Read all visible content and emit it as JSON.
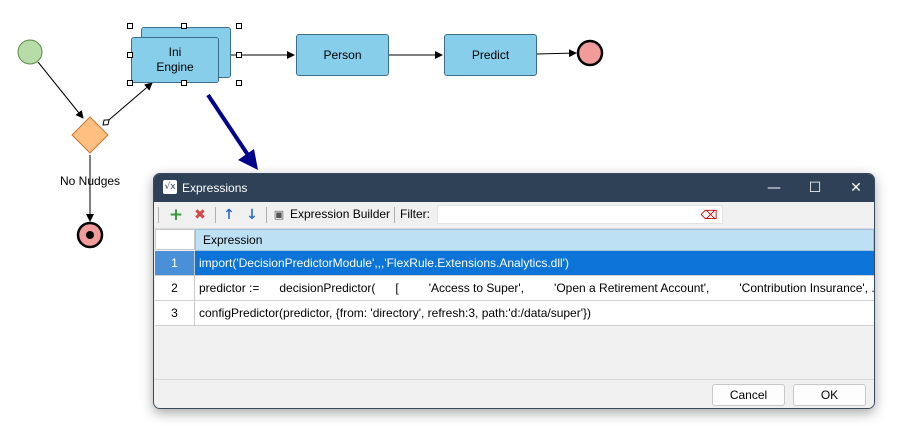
{
  "diagram": {
    "nodes": {
      "init_engine_line1": "Ini",
      "init_engine_line2": "Engine",
      "person": "Person",
      "predict": "Predict"
    },
    "gateway_label": "No Nudges"
  },
  "dialog": {
    "title": "Expressions",
    "window_controls": {
      "minimize": "—",
      "maximize": "☐",
      "close": "✕"
    },
    "toolbar": {
      "add_icon": "+",
      "remove_icon": "✖",
      "up_icon": "↑",
      "down_icon": "↓",
      "expression_builder": "Expression Builder",
      "filter_label": "Filter:",
      "filter_value": ""
    },
    "grid": {
      "column_header": "Expression",
      "rows": [
        {
          "num": "1",
          "expression": "import('DecisionPredictorModule',,,'FlexRule.Extensions.Analytics.dll')"
        },
        {
          "num": "2",
          "expression": "predictor :=      decisionPredictor(      [         'Access to Super',         'Open a Retirement Account',         'Contribution Insurance', ..."
        },
        {
          "num": "3",
          "expression": "configPredictor(predictor, {from: 'directory', refresh:3, path:'d:/data/super'})"
        }
      ]
    },
    "buttons": {
      "cancel": "Cancel",
      "ok": "OK"
    }
  },
  "colors": {
    "node_fill": "#87ceeb",
    "selection": "#0b74d6",
    "titlebar": "#2e4156",
    "arrow": "#00008b"
  }
}
